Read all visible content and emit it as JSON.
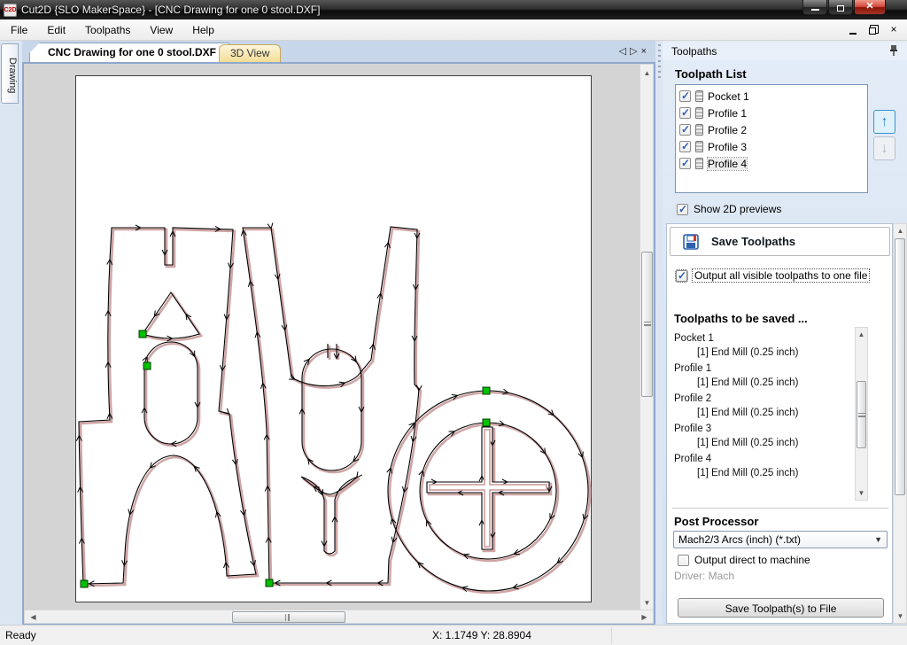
{
  "window": {
    "title": "Cut2D {SLO MakerSpace} - [CNC Drawing for one 0 stool.DXF]",
    "icon_text": "C2D"
  },
  "menu": {
    "file": "File",
    "edit": "Edit",
    "toolpaths": "Toolpaths",
    "view": "View",
    "help": "Help"
  },
  "tabs": {
    "drawing_doc": "CNC Drawing for one 0 stool.DXF",
    "view3d": "3D View",
    "side_flyout": "Drawing"
  },
  "toolpaths_panel": {
    "title": "Toolpaths",
    "list_title": "Toolpath List",
    "items": [
      {
        "label": "Pocket 1"
      },
      {
        "label": "Profile 1"
      },
      {
        "label": "Profile 2"
      },
      {
        "label": "Profile 3"
      },
      {
        "label": "Profile 4"
      }
    ],
    "show_previews_label": "Show 2D previews",
    "save_header": "Save Toolpaths",
    "output_one_file_label": "Output all visible toolpaths to one file",
    "to_be_saved_title": "Toolpaths to be saved ...",
    "save_list": [
      {
        "name": "Pocket 1",
        "tool": "[1] End Mill (0.25 inch)"
      },
      {
        "name": "Profile 1",
        "tool": "[1] End Mill (0.25 inch)"
      },
      {
        "name": "Profile 2",
        "tool": "[1] End Mill (0.25 inch)"
      },
      {
        "name": "Profile 3",
        "tool": "[1] End Mill (0.25 inch)"
      },
      {
        "name": "Profile 4",
        "tool": "[1] End Mill (0.25 inch)"
      }
    ],
    "post_processor_label": "Post Processor",
    "post_processor_value": "Mach2/3 Arcs (inch) (*.txt)",
    "output_direct_label": "Output direct to machine",
    "driver_label": "Driver: Mach",
    "save_button_label": "Save Toolpath(s) to File"
  },
  "status_bar": {
    "ready": "Ready",
    "coords": "X: 1.1749 Y: 28.8904"
  },
  "colors": {
    "toolpath_cut": "#000000",
    "toolpath_offset": "#cfa5a5",
    "start_marker": "#00c000",
    "tab_3d_accent": "#f4dc94",
    "close_button": "#b03a2a"
  }
}
